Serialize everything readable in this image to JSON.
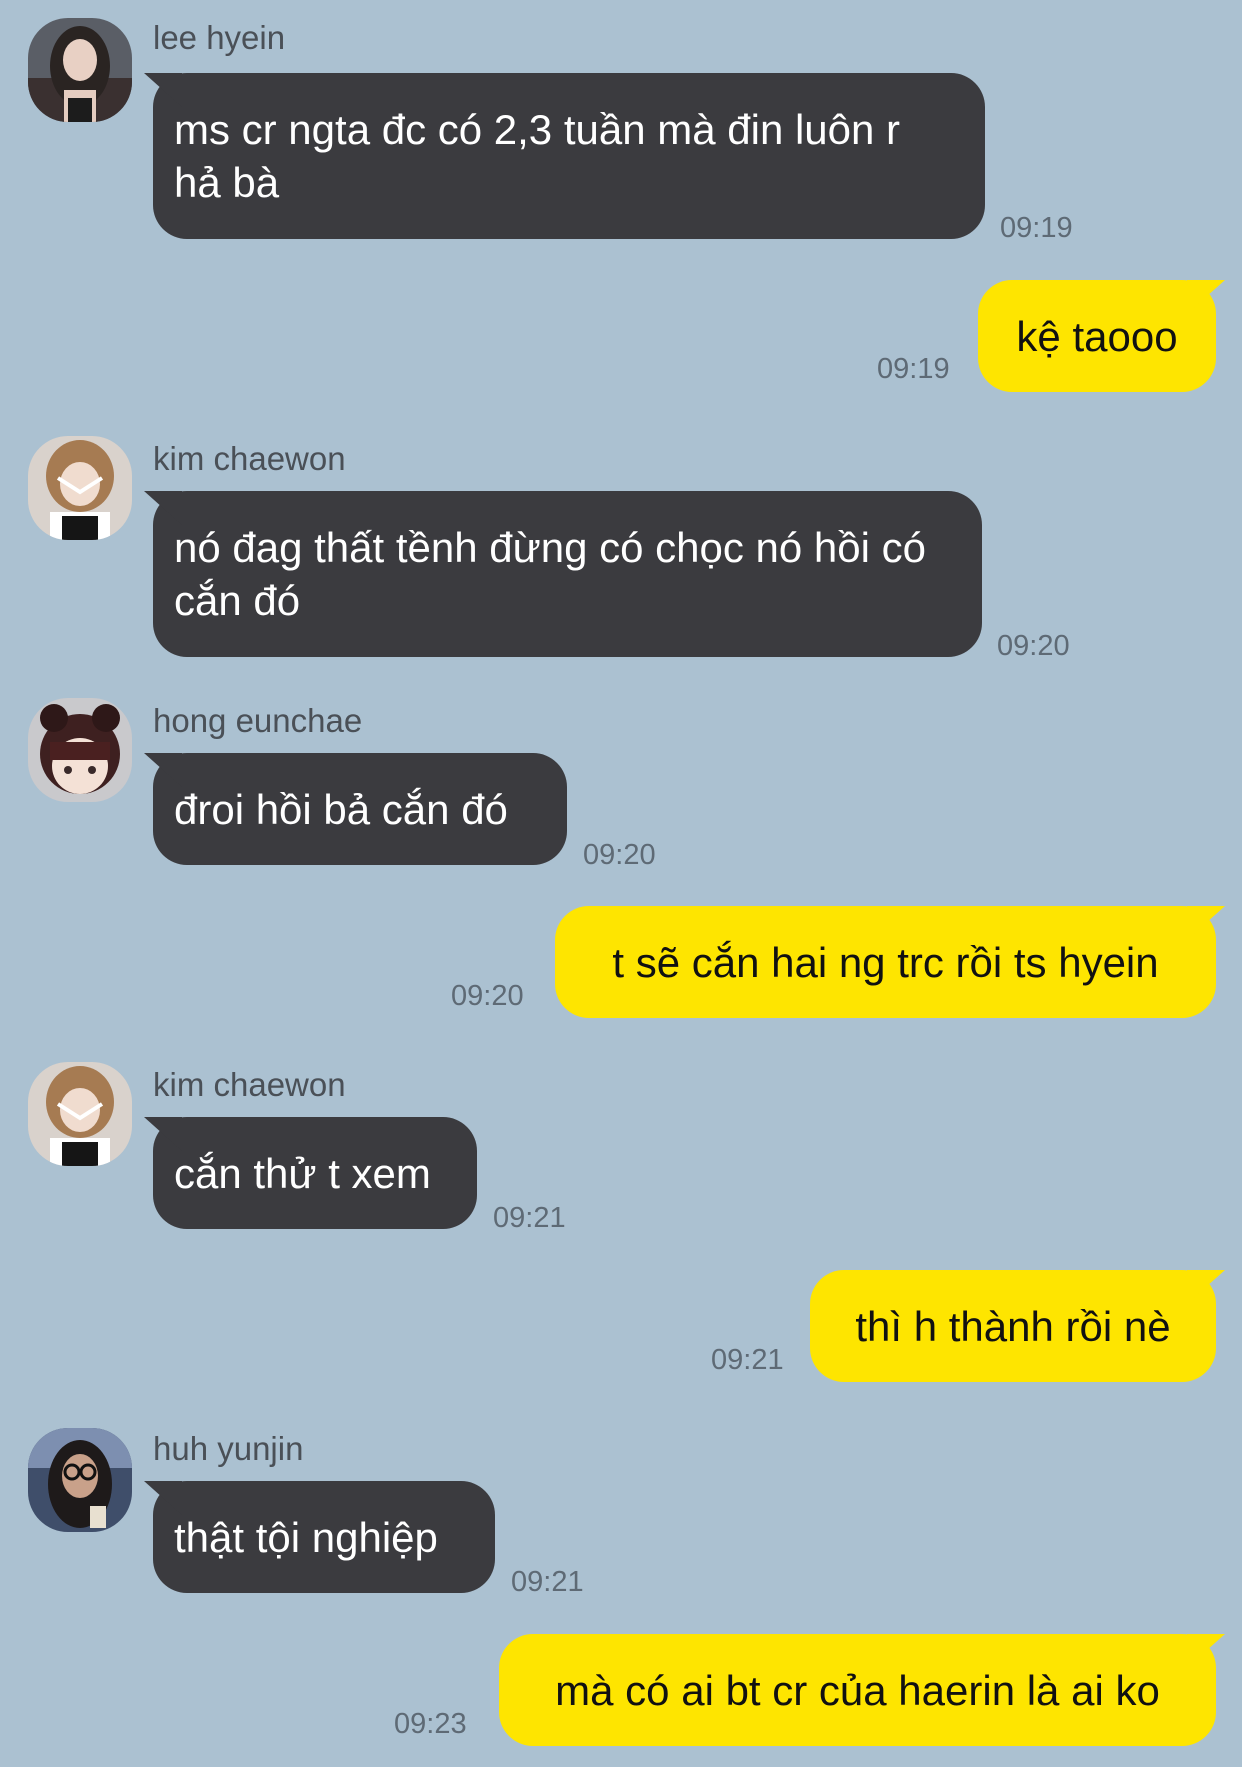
{
  "messages": [
    {
      "sender": "lee hyein",
      "text": "ms cr ngta đc có 2,3 tuần mà đin luôn r hả bà",
      "time": "09:19"
    },
    {
      "sender": "me",
      "text": "kệ taooo",
      "time": "09:19"
    },
    {
      "sender": "kim chaewon",
      "text": "nó đag thất tềnh đừng có chọc nó hồi có cắn đó",
      "time": "09:20"
    },
    {
      "sender": "hong eunchae",
      "text": "đroi hồi bả cắn đó",
      "time": "09:20"
    },
    {
      "sender": "me",
      "text": "t sẽ cắn hai ng trc rồi ts hyein",
      "time": "09:20"
    },
    {
      "sender": "kim chaewon",
      "text": "cắn thử t xem",
      "time": "09:21"
    },
    {
      "sender": "me",
      "text": "thì h thành rồi nè",
      "time": "09:21"
    },
    {
      "sender": "huh yunjin",
      "text": "thật tội nghiệp",
      "time": "09:21"
    },
    {
      "sender": "me",
      "text": "mà có ai bt cr của haerin là ai ko",
      "time": "09:23"
    }
  ],
  "colors": {
    "background": "#abc1d1",
    "incoming_bubble": "#3b3b3f",
    "outgoing_bubble": "#fee500"
  }
}
